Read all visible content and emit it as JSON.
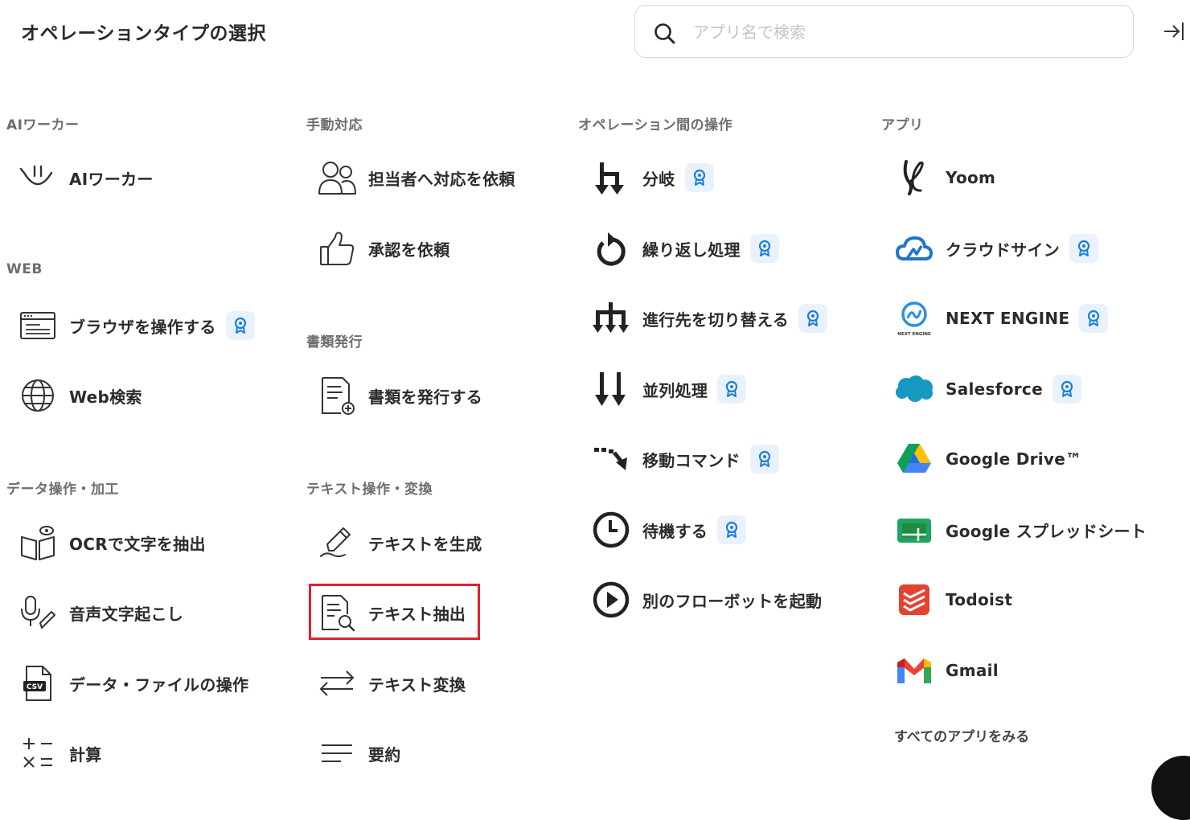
{
  "header": {
    "title": "オペレーションタイプの選択",
    "search_placeholder": "アプリ名で検索"
  },
  "sections": {
    "ai_worker": "AIワーカー",
    "web": "WEB",
    "data_ops": "データ操作・加工",
    "manual": "手動対応",
    "documents": "書類発行",
    "text_ops": "テキスト操作・変換",
    "between_ops": "オペレーション間の操作",
    "apps": "アプリ"
  },
  "items": {
    "ai_worker": "AIワーカー",
    "browser": "ブラウザを操作する",
    "web_search": "Web検索",
    "ocr": "OCRで文字を抽出",
    "transcribe": "音声文字起こし",
    "data_file": "データ・ファイルの操作",
    "calc": "計算",
    "assign": "担当者へ対応を依頼",
    "approval": "承認を依頼",
    "issue_doc": "書類を発行する",
    "gen_text": "テキストを生成",
    "extract_text": "テキスト抽出",
    "convert_text": "テキスト変換",
    "summary": "要約",
    "branch": "分岐",
    "loop": "繰り返し処理",
    "switch": "進行先を切り替える",
    "parallel": "並列処理",
    "move": "移動コマンド",
    "wait": "待機する",
    "start_bot": "別のフローボットを起動"
  },
  "apps": {
    "yoom": "Yoom",
    "cloudsign": "クラウドサイン",
    "nextengine": "NEXT ENGINE",
    "salesforce": "Salesforce",
    "gdrive": "Google Drive™",
    "gsheets": "Google スプレッドシート",
    "todoist": "Todoist",
    "gmail": "Gmail",
    "see_all": "すべてのアプリをみる"
  },
  "logo_text": {
    "nextengine": "NEXT ENGINE",
    "csv": "CSV"
  },
  "colors": {
    "badge_bg": "#e9f2fc",
    "badge_icon": "#1a7fd6",
    "highlight": "#e0202e"
  }
}
